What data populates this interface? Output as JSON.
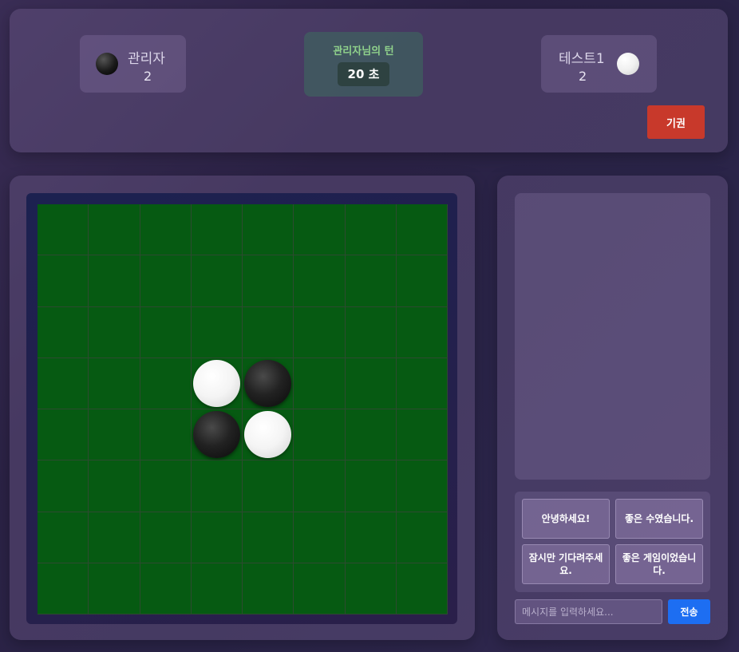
{
  "header": {
    "left_player": {
      "name": "관리자",
      "score": "2",
      "color": "black"
    },
    "right_player": {
      "name": "테스트1",
      "score": "2",
      "color": "white"
    },
    "turn_text": "관리자님의 턴",
    "timer": "20 초",
    "resign_label": "기권"
  },
  "board": {
    "size": 8,
    "cells": [
      [
        null,
        null,
        null,
        null,
        null,
        null,
        null,
        null
      ],
      [
        null,
        null,
        null,
        null,
        null,
        null,
        null,
        null
      ],
      [
        null,
        null,
        null,
        null,
        null,
        null,
        null,
        null
      ],
      [
        null,
        null,
        null,
        "white",
        "black",
        null,
        null,
        null
      ],
      [
        null,
        null,
        null,
        "black",
        "white",
        null,
        null,
        null
      ],
      [
        null,
        null,
        null,
        null,
        null,
        null,
        null,
        null
      ],
      [
        null,
        null,
        null,
        null,
        null,
        null,
        null,
        null
      ],
      [
        null,
        null,
        null,
        null,
        null,
        null,
        null,
        null
      ]
    ]
  },
  "chat": {
    "quick_messages": [
      "안녕하세요!",
      "좋은 수였습니다.",
      "잠시만 기다려주세요.",
      "좋은 게임이었습니다."
    ],
    "input_placeholder": "메시지를 입력하세요...",
    "send_label": "전송"
  },
  "colors": {
    "board_green": "#065a12",
    "resign_red": "#c8392b",
    "send_blue": "#1d6ef2",
    "turn_green": "#8fd18b"
  }
}
